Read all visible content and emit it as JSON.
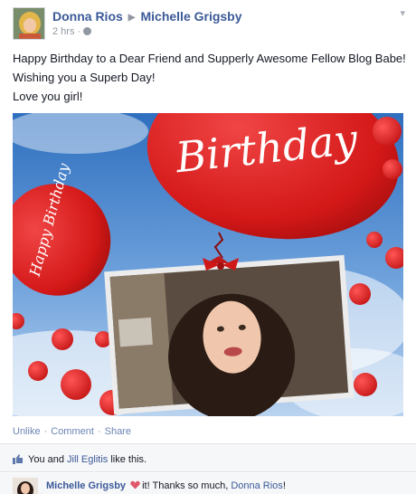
{
  "post": {
    "author": "Donna Rios",
    "recipient": "Michelle Grigsby",
    "timestamp": "2 hrs",
    "privacy_icon": "globe-icon",
    "menu_icon": "chevron-down-icon",
    "message_lines": [
      "Happy Birthday to a Dear Friend and Supperly Awesome Fellow Blog Babe!",
      "Wishing you a Superb Day!",
      "Love you girl!"
    ],
    "photo": {
      "balloon_text_big": "Birthday",
      "balloon_text_small": "Happy Birthday"
    }
  },
  "actions": {
    "unlike": "Unlike",
    "comment": "Comment",
    "share": "Share"
  },
  "likes": {
    "icon": "thumbs-up-icon",
    "prefix": "You and",
    "person": "Jill Eglitis",
    "suffix": "like this."
  },
  "comment": {
    "author": "Michelle Grigsby",
    "icon": "heart-icon",
    "text": "it! Thanks so much,",
    "mention": "Donna Rios",
    "end": "!"
  },
  "colors": {
    "link": "#3b5998",
    "balloon": "#d91f1f",
    "sky": "#3a7bc4"
  }
}
